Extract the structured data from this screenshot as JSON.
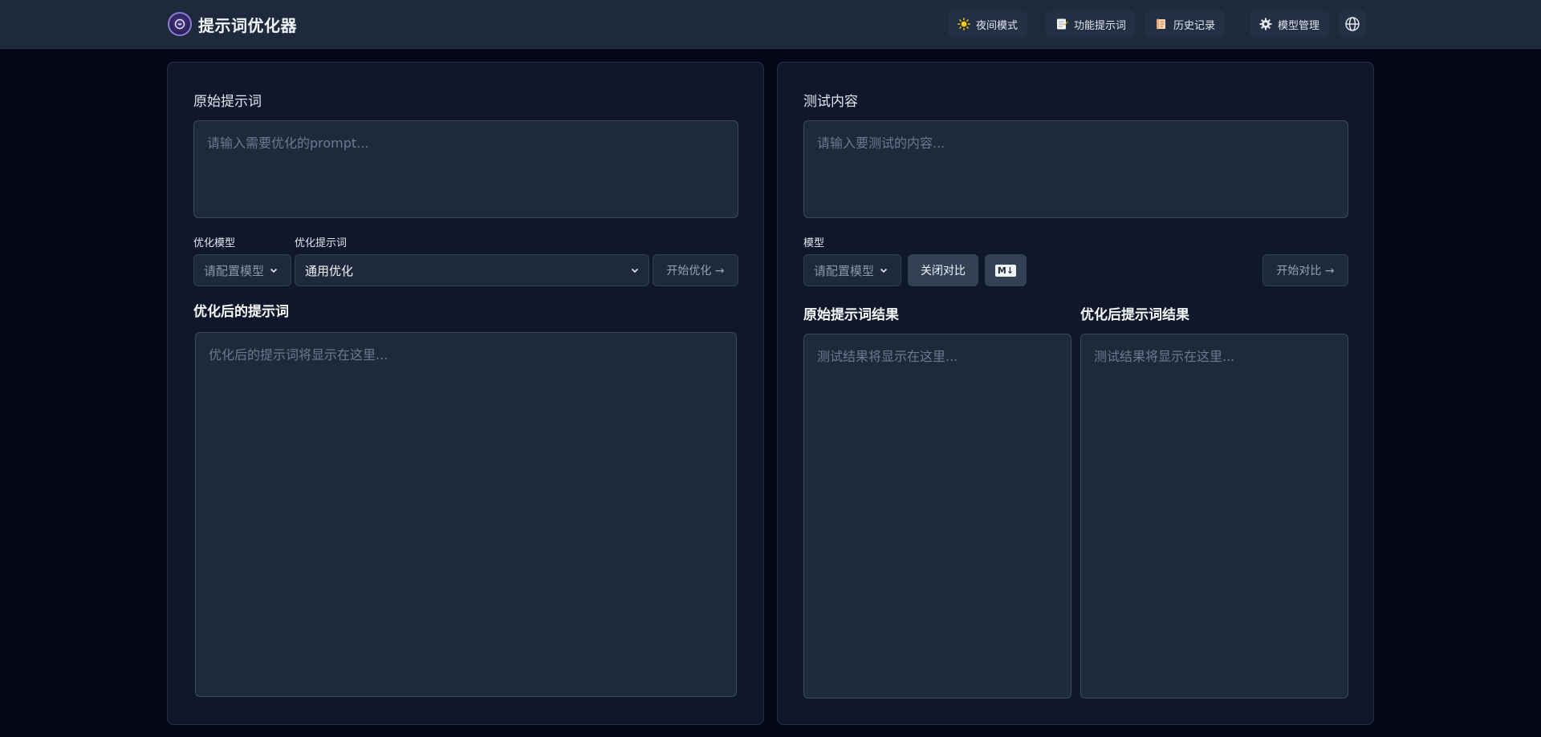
{
  "app": {
    "title": "提示词优化器"
  },
  "header": {
    "nav": [
      {
        "label": "夜间模式",
        "icon": "sun-icon"
      },
      {
        "label": "功能提示词",
        "icon": "memo-icon"
      },
      {
        "label": "历史记录",
        "icon": "scroll-icon"
      },
      {
        "label": "模型管理",
        "icon": "gear-icon"
      }
    ],
    "language_icon": "globe-icon"
  },
  "left": {
    "input_label": "原始提示词",
    "input_placeholder": "请输入需要优化的prompt...",
    "model_label": "优化模型",
    "model_value": "请配置模型",
    "template_label": "优化提示词",
    "template_value": "通用优化",
    "start_button": "开始优化 →",
    "output_title": "优化后的提示词",
    "output_placeholder": "优化后的提示词将显示在这里..."
  },
  "right": {
    "input_label": "测试内容",
    "input_placeholder": "请输入要测试的内容...",
    "model_label": "模型",
    "model_value": "请配置模型",
    "compare_toggle": "关闭对比",
    "markdown_badge": "M↓",
    "start_button": "开始对比 →",
    "original_result_title": "原始提示词结果",
    "original_result_placeholder": "测试结果将显示在这里...",
    "optimized_result_title": "优化后提示词结果",
    "optimized_result_placeholder": "测试结果将显示在这里..."
  },
  "colors": {
    "background": "#020617",
    "header": "#1e293b",
    "panel": "#0f172a",
    "field": "#1e293b",
    "accent": "#8b7bd8"
  }
}
